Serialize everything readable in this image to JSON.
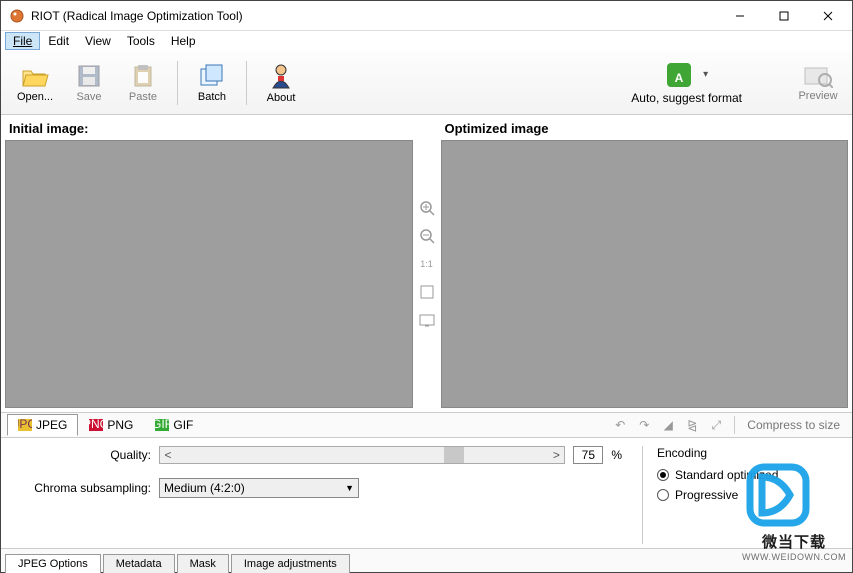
{
  "title": "RIOT (Radical Image Optimization Tool)",
  "menu": {
    "file": "File",
    "edit": "Edit",
    "view": "View",
    "tools": "Tools",
    "help": "Help"
  },
  "toolbar": {
    "open": "Open...",
    "save": "Save",
    "paste": "Paste",
    "batch": "Batch",
    "about": "About",
    "auto": "Auto, suggest format",
    "preview": "Preview"
  },
  "panes": {
    "left": "Initial image:",
    "right": "Optimized image"
  },
  "zoom": {
    "oneToOne": "1:1"
  },
  "formats": {
    "jpeg": "JPEG",
    "png": "PNG",
    "gif": "GIF"
  },
  "compressToSize": "Compress to size",
  "quality": {
    "label": "Quality:",
    "value": "75",
    "pct": "%"
  },
  "chroma": {
    "label": "Chroma subsampling:",
    "value": "Medium (4:2:0)"
  },
  "encoding": {
    "title": "Encoding",
    "standard": "Standard optimized",
    "progressive": "Progressive"
  },
  "bottomTabs": {
    "jpegOptions": "JPEG Options",
    "metadata": "Metadata",
    "mask": "Mask",
    "imageAdj": "Image adjustments"
  },
  "watermark": {
    "line1": "微当下载",
    "line2": "WWW.WEIDOWN.COM"
  }
}
